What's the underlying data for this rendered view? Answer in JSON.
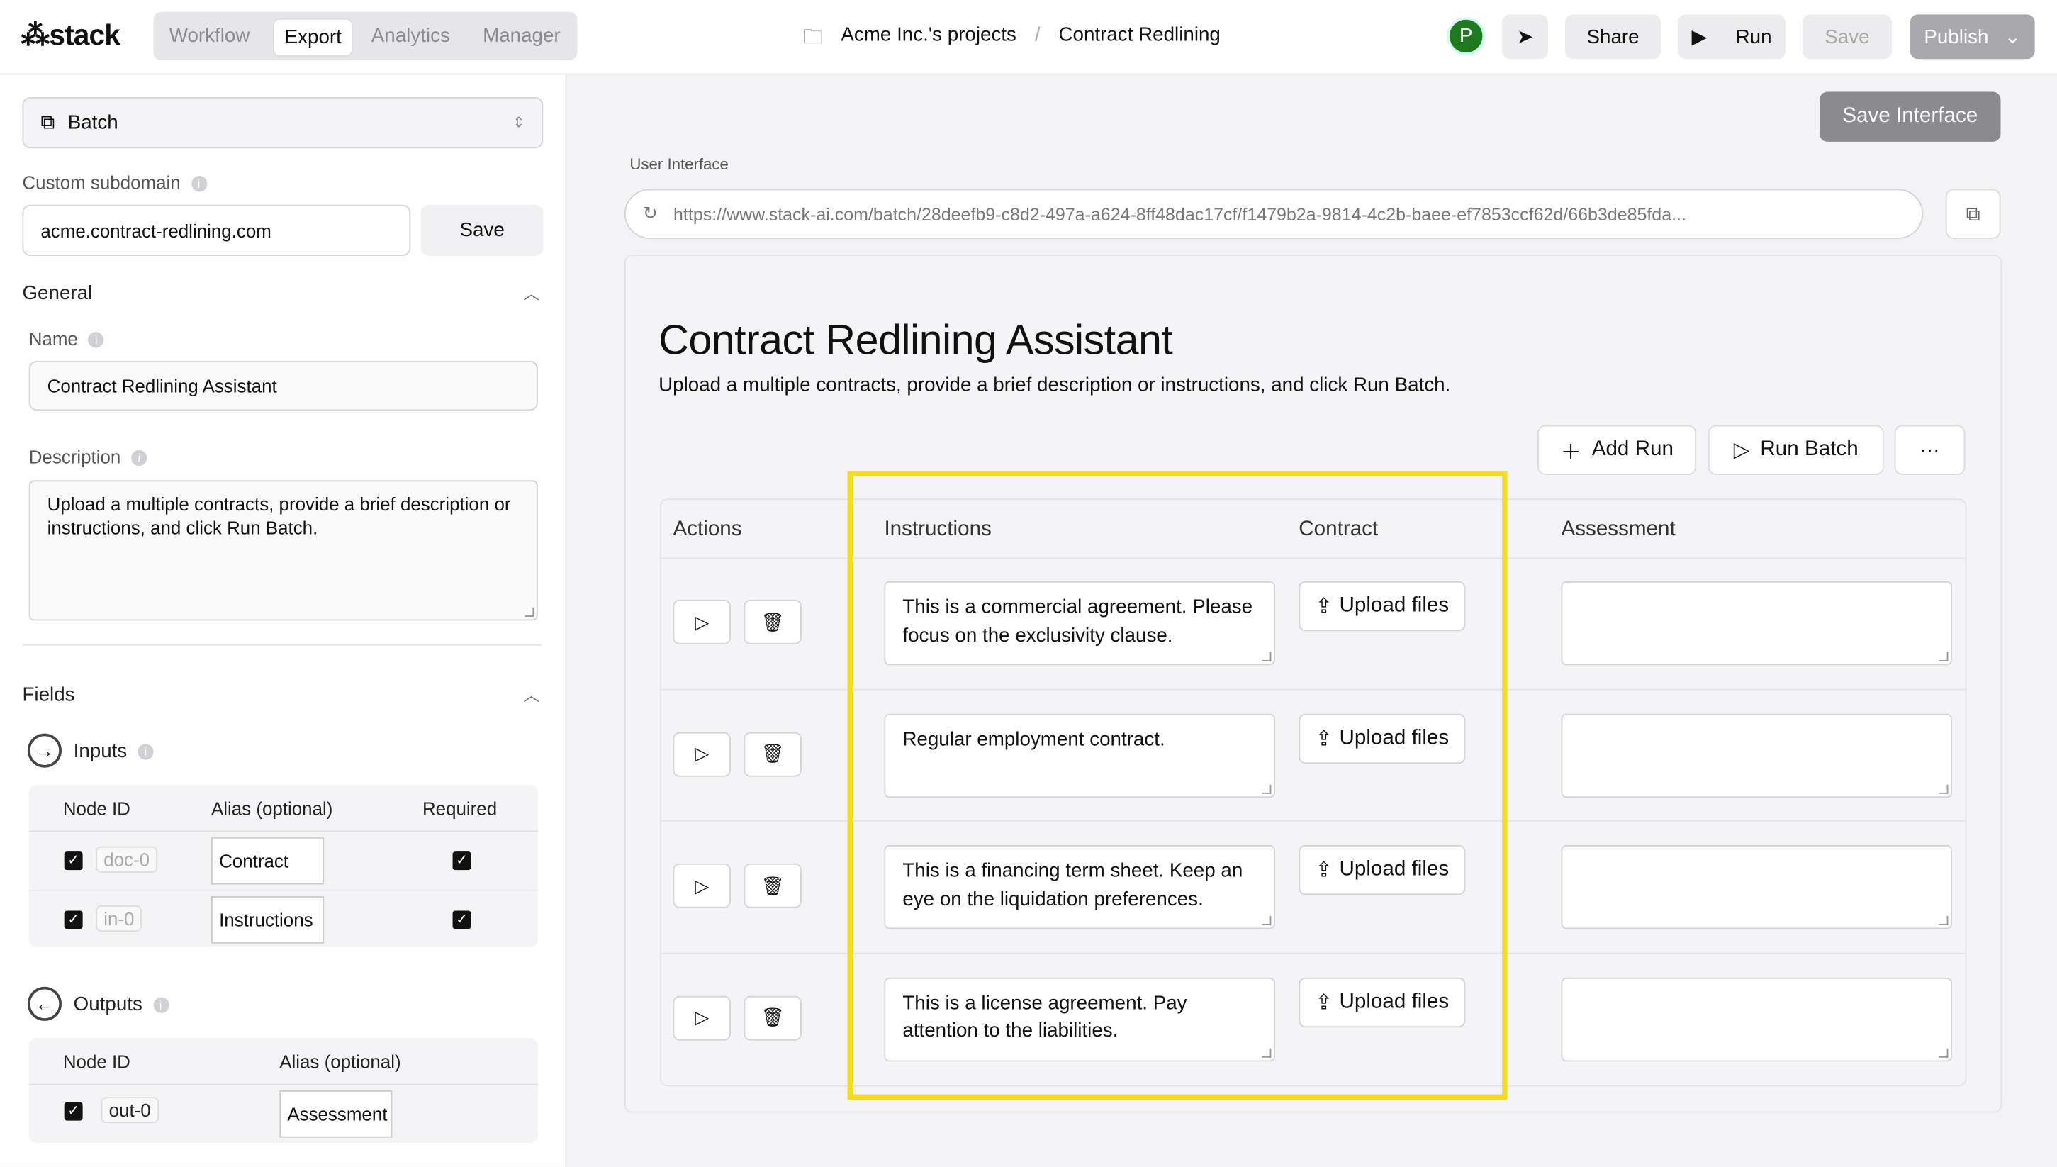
{
  "brand": "stack",
  "nav": {
    "tabs": [
      "Workflow",
      "Export",
      "Analytics",
      "Manager"
    ],
    "active": "Export"
  },
  "breadcrumb": {
    "project": "Acme Inc.'s projects",
    "separator": "/",
    "page": "Contract Redlining"
  },
  "header": {
    "avatar": "P",
    "avatar_color": "#1f7a1f",
    "share": "Share",
    "run": "Run",
    "save": "Save",
    "publish": "Publish"
  },
  "sidebar": {
    "mode": "Batch",
    "subdomain_label": "Custom subdomain",
    "subdomain_value": "acme.contract-redlining.com",
    "subdomain_save": "Save",
    "general_label": "General",
    "name_label": "Name",
    "name_value": "Contract Redlining Assistant",
    "description_label": "Description",
    "description_value": "Upload a multiple contracts, provide a brief description or instructions, and click Run Batch.",
    "fields_label": "Fields",
    "inputs": {
      "label": "Inputs",
      "headers": [
        "Node ID",
        "Alias (optional)",
        "Required"
      ],
      "rows": [
        {
          "node": "doc-0",
          "alias": "Contract",
          "checked": true,
          "required": true
        },
        {
          "node": "in-0",
          "alias": "Instructions",
          "checked": true,
          "required": true
        }
      ]
    },
    "outputs": {
      "label": "Outputs",
      "headers": [
        "Node ID",
        "Alias (optional)"
      ],
      "rows": [
        {
          "node": "out-0",
          "alias": "Assessment",
          "checked": true
        }
      ]
    }
  },
  "main": {
    "save_interface": "Save Interface",
    "ui_label": "User Interface",
    "url": "https://www.stack-ai.com/batch/28deefb9-c8d2-497a-a624-8ff48dac17cf/f1479b2a-9814-4c2b-baee-ef7853ccf62d/66b3de85fda...",
    "title": "Contract Redlining Assistant",
    "subtitle": "Upload a multiple contracts, provide a brief description or instructions, and click Run Batch.",
    "add_run": "Add Run",
    "run_batch": "Run Batch",
    "more": "···",
    "columns": [
      "Actions",
      "Instructions",
      "Contract",
      "Assessment"
    ],
    "upload_label": "Upload files",
    "rows": [
      {
        "instructions": "This is a commercial agreement. Please focus on the exclusivity clause.",
        "assessment": ""
      },
      {
        "instructions": "Regular employment contract.",
        "assessment": ""
      },
      {
        "instructions": "This is a financing term sheet. Keep an eye on the liquidation preferences.",
        "assessment": ""
      },
      {
        "instructions": "This is a license agreement. Pay attention to the liabilities.",
        "assessment": ""
      }
    ],
    "highlight_color": "#f5dc1f"
  }
}
